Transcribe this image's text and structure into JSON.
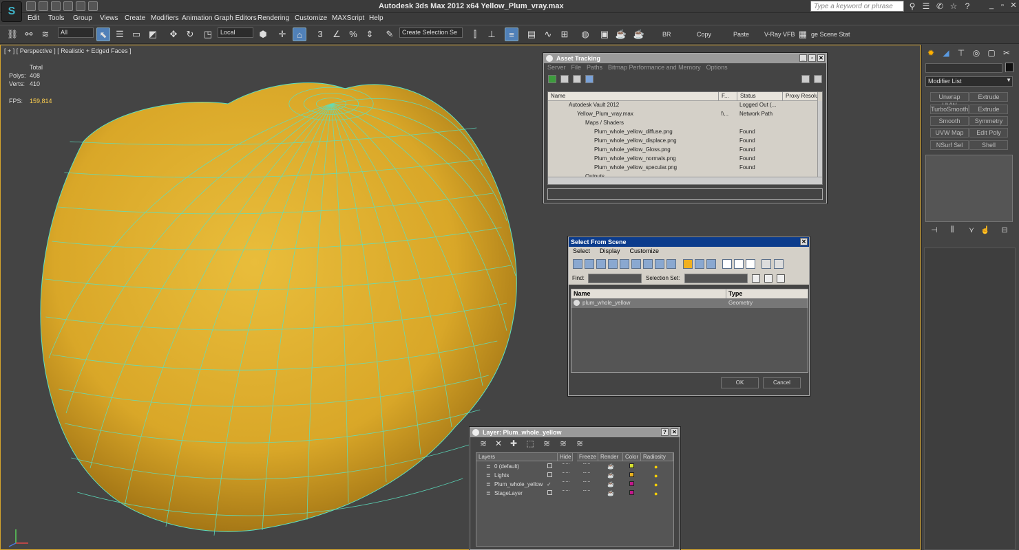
{
  "app": {
    "logo": "S",
    "title": "Autodesk 3ds Max  2012 x64     Yellow_Plum_vray.max",
    "search_placeholder": "Type a keyword or phrase"
  },
  "menus": [
    "Edit",
    "Tools",
    "Group",
    "Views",
    "Create",
    "Modifiers",
    "Animation",
    "Graph Editors",
    "Rendering",
    "Customize",
    "MAXScript",
    "Help"
  ],
  "toolbar": {
    "filter": "All",
    "coord_system": "Local",
    "selection_set": "Create Selection Se",
    "br_label": "BR",
    "copy_label": "Copy",
    "paste_label": "Paste",
    "vray_label": "V-Ray VFB",
    "scene_states_label": "ge Scene Stat"
  },
  "viewport": {
    "label": "[ + ] [ Perspective ] [ Realistic + Edged Faces ]",
    "stats_header": "Total",
    "polys_label": "Polys:",
    "polys_value": "408",
    "verts_label": "Verts:",
    "verts_value": "410",
    "fps_label": "FPS:",
    "fps_value": "159,814",
    "object_color": "#d9a728",
    "wire_color": "#5ce0c0"
  },
  "command_panel": {
    "modifier_list": "Modifier List",
    "buttons": [
      "Unwrap UVW",
      "Extrude",
      "TurboSmooth",
      "Extrude",
      "Smooth",
      "Symmetry",
      "UVW Map",
      "Edit Poly",
      "NSurf Sel",
      "Shell"
    ]
  },
  "asset_tracking": {
    "title": "Asset Tracking",
    "menu": [
      "Server",
      "File",
      "Paths",
      "Bitmap Performance and Memory",
      "Options"
    ],
    "columns": [
      "Name",
      "F...",
      "Status",
      "Proxy Resolu"
    ],
    "rows": [
      {
        "name": "Autodesk Vault 2012",
        "f": "",
        "status": "Logged Out (..."
      },
      {
        "name": "Yellow_Plum_vray.max",
        "f": "\\\\...",
        "status": "Network Path"
      },
      {
        "name": "Maps / Shaders",
        "f": "",
        "status": ""
      },
      {
        "name": "Plum_whole_yellow_diffuse.png",
        "f": "",
        "status": "Found"
      },
      {
        "name": "Plum_whole_yellow_displace.png",
        "f": "",
        "status": "Found"
      },
      {
        "name": "Plum_whole_yellow_Gloss.png",
        "f": "",
        "status": "Found"
      },
      {
        "name": "Plum_whole_yellow_normals.png",
        "f": "",
        "status": "Found"
      },
      {
        "name": "Plum_whole_yellow_specular.png",
        "f": "",
        "status": "Found"
      },
      {
        "name": "Outputs",
        "f": "",
        "status": ""
      }
    ]
  },
  "select_from_scene": {
    "title": "Select From Scene",
    "menu": [
      "Select",
      "Display",
      "Customize"
    ],
    "find_label": "Find:",
    "selection_set_label": "Selection Set:",
    "col_name": "Name",
    "col_type": "Type",
    "rows": [
      {
        "name": "plum_whole_yellow",
        "type": "Geometry"
      }
    ],
    "ok": "OK",
    "cancel": "Cancel"
  },
  "layer": {
    "title": "Layer: Plum_whole_yellow",
    "columns": [
      "Layers",
      "Hide",
      "Freeze",
      "Render",
      "Color",
      "Radiosity"
    ],
    "rows": [
      {
        "name": "0 (default)",
        "color": "#d6e030",
        "current": false
      },
      {
        "name": "Lights",
        "color": "#e8b020",
        "current": false
      },
      {
        "name": "Plum_whole_yellow",
        "color": "#c0188a",
        "current": true
      },
      {
        "name": "StageLayer",
        "color": "#c0188a",
        "current": false
      }
    ]
  }
}
